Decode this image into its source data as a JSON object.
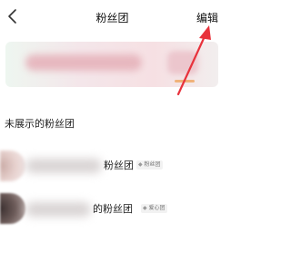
{
  "header": {
    "title": "粉丝团",
    "edit_label": "编辑"
  },
  "section": {
    "title": "未展示的粉丝团"
  },
  "groups": [
    {
      "name_suffix": "粉丝团",
      "badge_text": "粉丝团"
    },
    {
      "name_suffix": "的粉丝团",
      "badge_text": "爱心团"
    }
  ],
  "colors": {
    "arrow": "#e8323c",
    "banner_blur": "#e6b3bb"
  }
}
